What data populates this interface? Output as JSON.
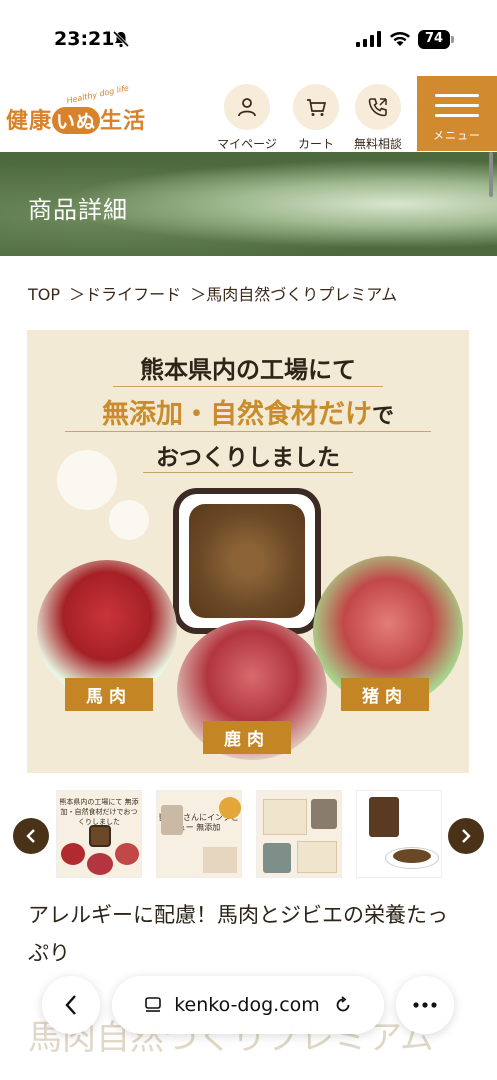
{
  "status_bar": {
    "time": "23:21",
    "battery": "74"
  },
  "header": {
    "logo_text_1": "健康",
    "logo_text_circle": "いぬ",
    "logo_text_2": "生活",
    "logo_tagline": "Healthy dog life",
    "icons": [
      {
        "label": "マイページ",
        "icon": "person-icon"
      },
      {
        "label": "カート",
        "icon": "cart-icon"
      },
      {
        "label": "無料相談",
        "icon": "phone-icon"
      }
    ],
    "menu_label": "メニュー"
  },
  "hero": {
    "title": "商品詳細"
  },
  "breadcrumb": {
    "items": [
      "TOP",
      "＞ドライフード",
      "＞馬肉自然づくりプレミアム"
    ]
  },
  "main_image": {
    "line1": "熊本県内の工場にて",
    "line2": "無添加・自然食材だけ",
    "line2_suffix": "で",
    "line3": "おつくりしました",
    "labels": [
      "馬肉",
      "鹿肉",
      "猪肉"
    ]
  },
  "thumbnails": [
    {
      "text": "熊本県内の工場にて 無添加・自然食材だけでおつくりしました"
    },
    {
      "text": "獣医師さんにインタビュー 無添加"
    },
    {
      "text": ""
    },
    {
      "text": ""
    }
  ],
  "description": {
    "text": "アレルギーに配慮！馬肉とジビエの栄養たっぷり",
    "ghost_title": "馬肉自然づくりプレミアム"
  },
  "safari": {
    "url": "kenko-dog.com"
  },
  "colors": {
    "accent": "#d28a2f",
    "dark_brown": "#4a3218",
    "cream": "#f3ead6"
  }
}
